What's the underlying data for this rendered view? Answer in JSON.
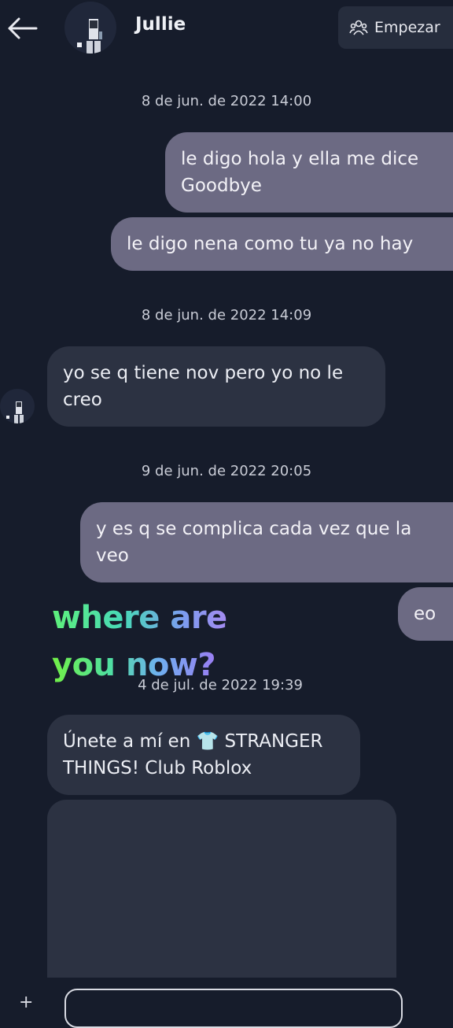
{
  "header": {
    "contact_name": "Jullie",
    "start_label": "Empezar"
  },
  "messages": [
    {
      "timestamp": "8 de jun. de 2022 14:00"
    },
    {
      "text": "le digo hola y ella me dice Goodbye"
    },
    {
      "text": "le digo nena como tu ya no hay"
    },
    {
      "timestamp": "8 de jun. de 2022 14:09"
    },
    {
      "text": "yo se q tiene nov pero yo no le creo"
    },
    {
      "timestamp": "9 de jun. de 2022 20:05"
    },
    {
      "text": "y es q se complica cada vez que la veo"
    },
    {
      "text": "eo"
    },
    {
      "timestamp": "4 de jul. de 2022 19:39"
    },
    {
      "text": "Únete a mí en 👕 STRANGER THINGS! Club Roblox"
    }
  ],
  "overlay": {
    "line1": "where are",
    "line2": "you now?"
  },
  "colors": {
    "background": "#161c2b",
    "outgoing_bubble": "#6c6a83",
    "incoming_bubble": "#2c3242"
  },
  "icons": [
    "back-arrow-icon",
    "people-icon",
    "plus-icon"
  ]
}
